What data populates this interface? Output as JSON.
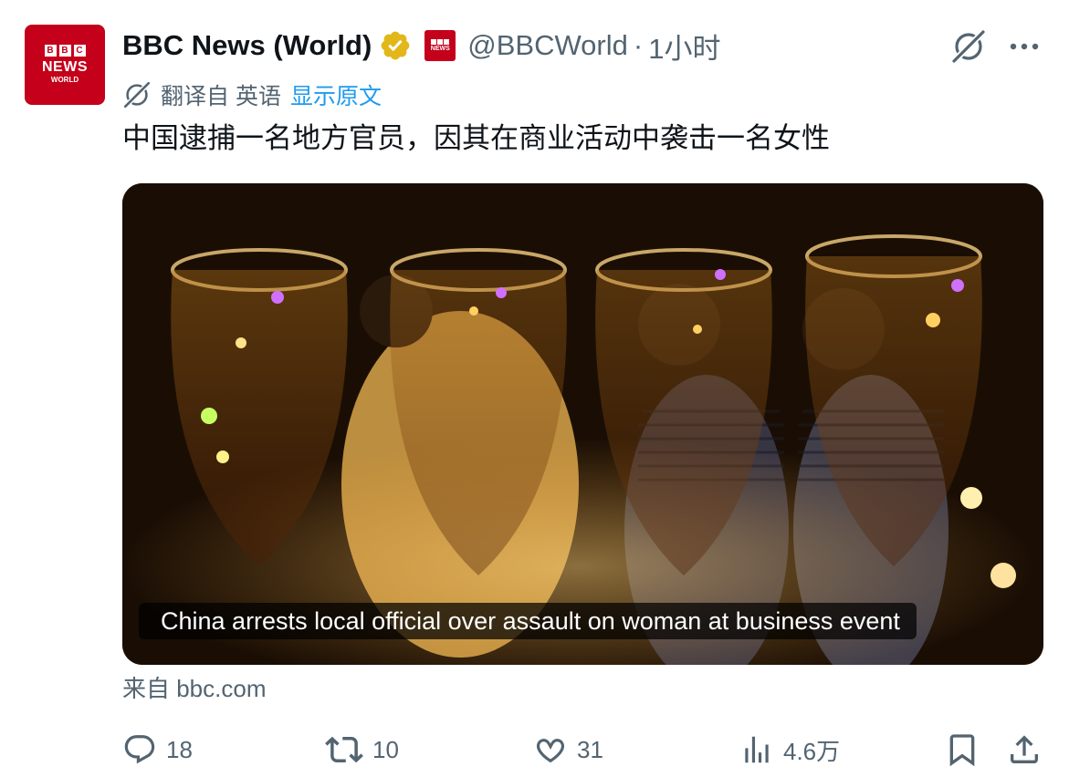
{
  "author": {
    "display_name": "BBC News (World)",
    "handle": "@BBCWorld",
    "separator": "·",
    "time": "1小时",
    "avatar_lines": {
      "blocks": [
        "B",
        "B",
        "C"
      ],
      "news": "NEWS",
      "world": "WORLD"
    }
  },
  "translation": {
    "label": "翻译自 英语",
    "show_original": "显示原文"
  },
  "tweet": {
    "text": "中国逮捕一名地方官员，因其在商业活动中袭击一名女性"
  },
  "card": {
    "caption": "China arrests local official over assault on woman at business event"
  },
  "source": "来自 bbc.com",
  "actions": {
    "replies": "18",
    "retweets": "10",
    "likes": "31",
    "views": "4.6万"
  },
  "icons": {
    "verified": "verified-badge-icon",
    "grok": "grok-icon",
    "more": "more-icon",
    "reply": "reply-icon",
    "retweet": "retweet-icon",
    "like": "like-icon",
    "views": "views-icon",
    "bookmark": "bookmark-icon",
    "share": "share-icon"
  },
  "colors": {
    "brand_red": "#c4001a",
    "link_blue": "#1d9bf0",
    "secondary_text": "#536471",
    "verified_gold": "#e2b719"
  }
}
